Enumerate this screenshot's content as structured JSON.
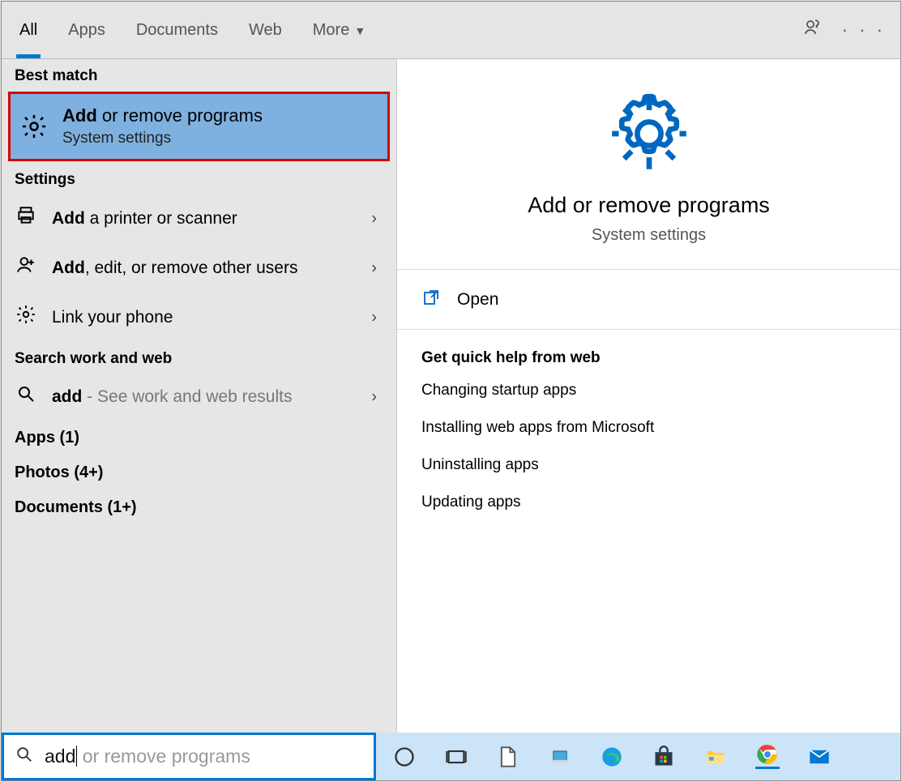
{
  "tabs": {
    "all": "All",
    "apps": "Apps",
    "documents": "Documents",
    "web": "Web",
    "more": "More"
  },
  "best_match": {
    "label": "Best match",
    "item": {
      "bold": "Add",
      "rest": " or remove programs",
      "sub": "System settings"
    }
  },
  "settings": {
    "label": "Settings",
    "items": [
      {
        "bold": "Add",
        "rest": " a printer or scanner"
      },
      {
        "bold": "Add",
        "rest": ", edit, or remove other users"
      },
      {
        "bold": "",
        "rest": "Link your phone"
      }
    ]
  },
  "search_section": {
    "label": "Search work and web",
    "query_bold": "add",
    "hint": " - See work and web results"
  },
  "more_groups": {
    "apps": "Apps (1)",
    "photos": "Photos (4+)",
    "documents": "Documents (1+)"
  },
  "preview": {
    "title": "Add or remove programs",
    "sub": "System settings",
    "open": "Open",
    "help_heading": "Get quick help from web",
    "help_links": [
      "Changing startup apps",
      "Installing web apps from Microsoft",
      "Uninstalling apps",
      "Updating apps"
    ]
  },
  "searchbar": {
    "typed": "add",
    "ghost": " or remove programs"
  }
}
